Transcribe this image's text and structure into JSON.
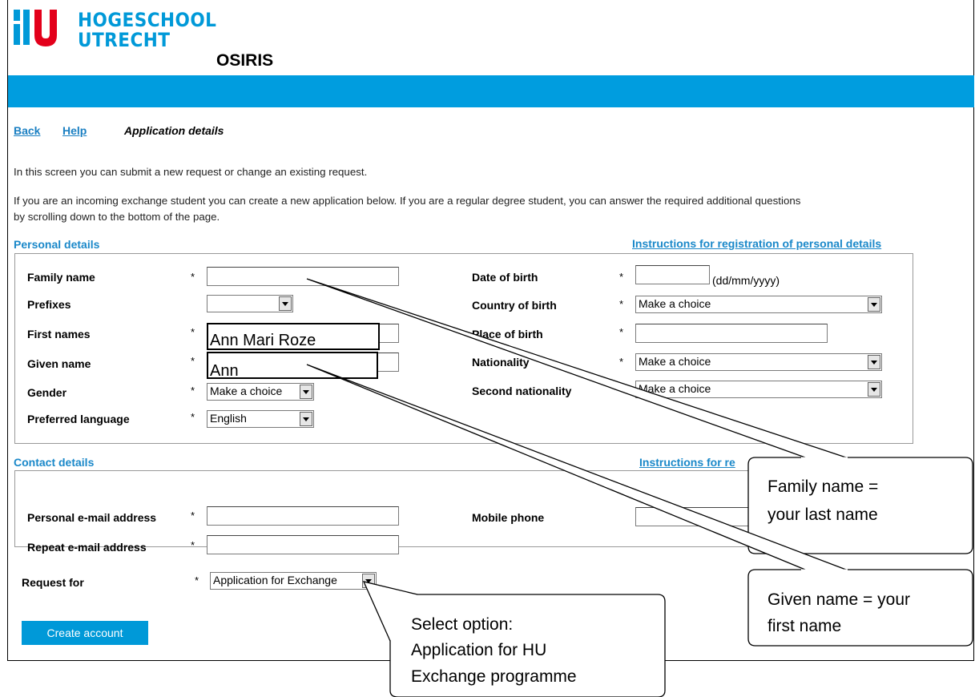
{
  "header": {
    "logo_line1": "HOGESCHOOL",
    "logo_line2": "UTRECHT",
    "app_name": "OSIRIS"
  },
  "nav": {
    "back": "Back",
    "help": "Help",
    "breadcrumb": "Application details"
  },
  "intro": {
    "line1": "In this screen you can submit a new request or change an existing request.",
    "line2": "If you are an incoming exchange student you can create a new application below. If you are a regular degree student, you can answer the required additional questions",
    "line3": "by scrolling down to the bottom of the page."
  },
  "personal": {
    "title": "Personal details",
    "instructions": "Instructions for registration of personal details",
    "family_name": "Family name",
    "prefixes": "Prefixes",
    "first_names": "First names",
    "given_name": "Given name",
    "gender": "Gender",
    "gender_value": "Make a choice",
    "preferred_language": "Preferred language",
    "preferred_language_value": "English",
    "date_of_birth": "Date of birth",
    "date_hint": "(dd/mm/yyyy)",
    "country_of_birth": "Country of birth",
    "country_value": "Make a choice",
    "place_of_birth": "Place of birth",
    "nationality": "Nationality",
    "nationality_value": "Make a choice",
    "second_nationality": "Second nationality",
    "second_nationality_value": "Make a choice",
    "star": "*"
  },
  "contact": {
    "title": "Contact details",
    "instructions": "Instructions for re",
    "email": "Personal e-mail address",
    "repeat_email": "Repeat e-mail address",
    "mobile": "Mobile phone"
  },
  "request": {
    "label": "Request for",
    "value": "Application for Exchange",
    "button": "Create account"
  },
  "overlays": {
    "first_names_value": "Ann Mari Roze",
    "given_name_value": "Ann"
  },
  "callouts": {
    "family_line1": "Family name =",
    "family_line2": "your last name",
    "given_line1": "Given name = your",
    "given_line2": "first name",
    "select_line1": "Select option:",
    "select_line2": "Application for HU",
    "select_line3": "Exchange programme"
  },
  "colors": {
    "brand_blue": "#009ddf",
    "link_blue": "#1a88c9"
  }
}
